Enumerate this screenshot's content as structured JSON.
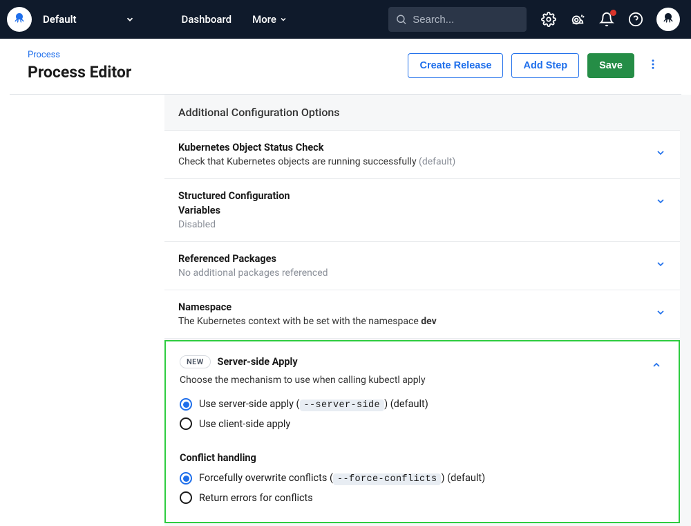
{
  "topbar": {
    "space": "Default",
    "nav": {
      "dashboard": "Dashboard",
      "more": "More"
    },
    "search_placeholder": "Search..."
  },
  "header": {
    "breadcrumb": "Process",
    "title": "Process Editor",
    "actions": {
      "create_release": "Create Release",
      "add_step": "Add Step",
      "save": "Save"
    }
  },
  "sections": {
    "additional_heading": "Additional Configuration Options",
    "k8s_status": {
      "title": "Kubernetes Object Status Check",
      "desc_prefix": "Check that Kubernetes objects are running successfully ",
      "desc_suffix": "(default)"
    },
    "struct_vars": {
      "line1": "Structured Configuration",
      "line2": "Variables",
      "line3": "Disabled"
    },
    "ref_packages": {
      "title": "Referenced Packages",
      "desc": "No additional packages referenced"
    },
    "namespace": {
      "title": "Namespace",
      "desc_prefix": "The Kubernetes context with be set with the namespace ",
      "desc_bold": "dev"
    },
    "ssa": {
      "badge": "NEW",
      "title": "Server-side Apply",
      "desc": "Choose the mechanism to use when calling kubectl apply",
      "opt1_prefix": "Use server-side apply (",
      "opt1_code": "--server-side",
      "opt1_suffix": ") (default)",
      "opt2": "Use client-side apply",
      "conflict_heading": "Conflict handling",
      "c_opt1_prefix": "Forcefully overwrite conflicts (",
      "c_opt1_code": "--force-conflicts",
      "c_opt1_suffix": ") (default)",
      "c_opt2": "Return errors for conflicts"
    }
  }
}
